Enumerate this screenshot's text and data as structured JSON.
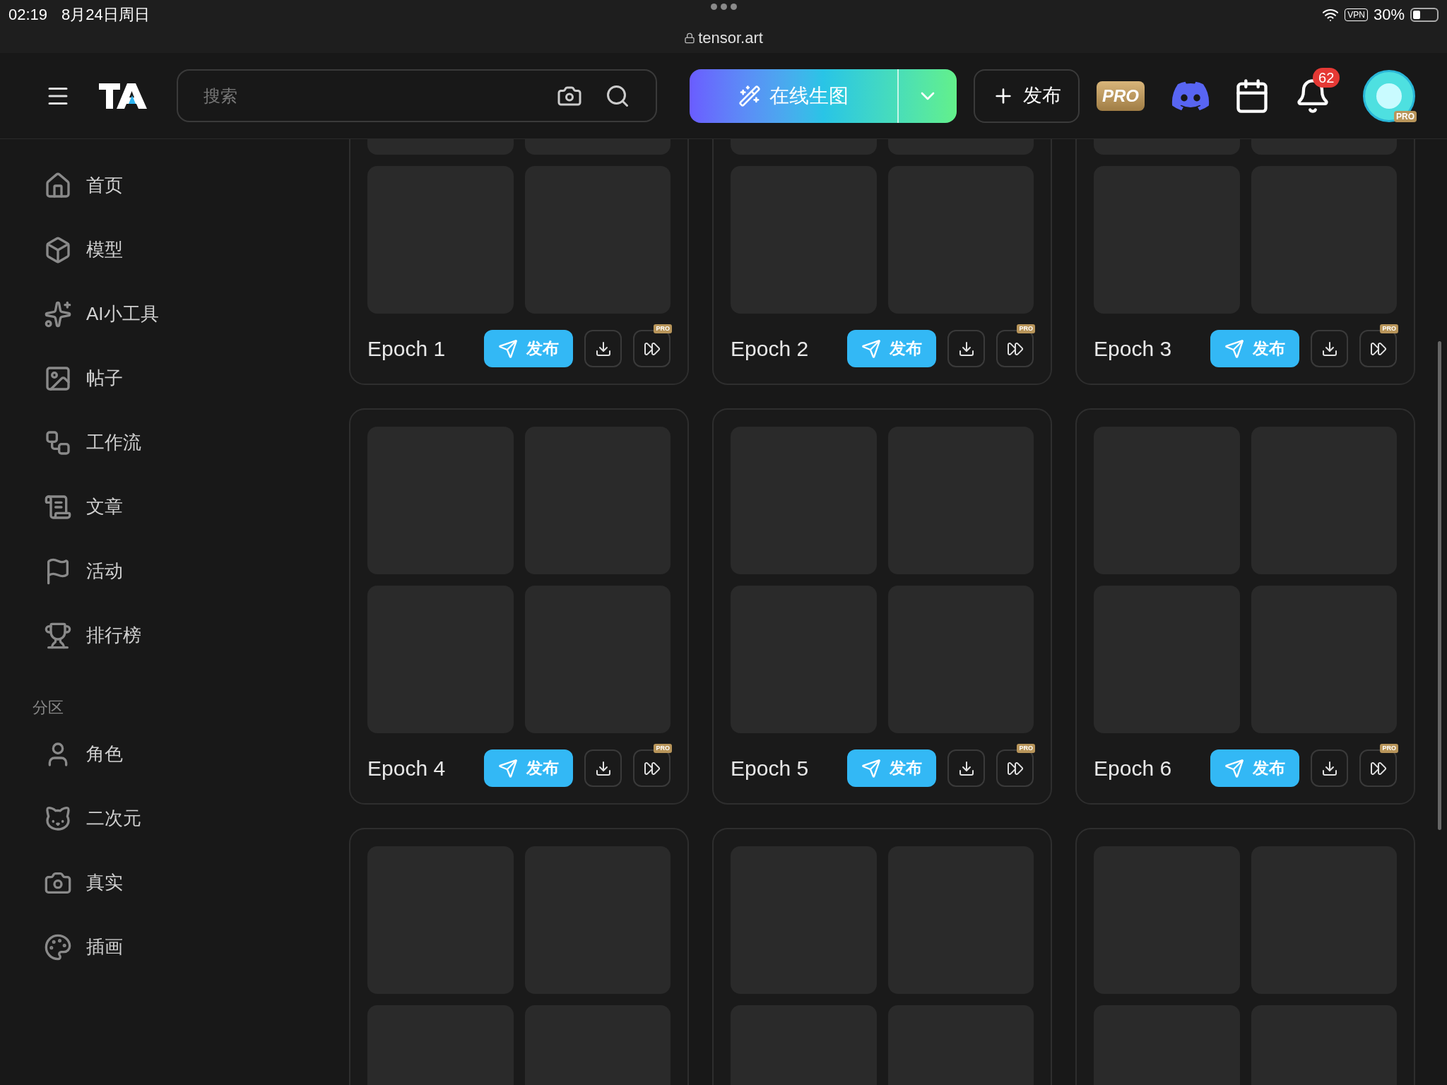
{
  "status_bar": {
    "time": "02:19",
    "date": "8月24日周日",
    "url": "tensor.art",
    "vpn": "VPN",
    "battery": "30%"
  },
  "header": {
    "search": {
      "placeholder": "搜索"
    },
    "generate": "在线生图",
    "publish": "发布",
    "pro": "PRO",
    "notifications": "62",
    "avatar_badge": "PRO"
  },
  "sidebar": {
    "items": [
      {
        "kind": "home",
        "label": "首页"
      },
      {
        "kind": "model",
        "label": "模型"
      },
      {
        "kind": "tools",
        "label": "AI小工具"
      },
      {
        "kind": "posts",
        "label": "帖子"
      },
      {
        "kind": "workflow",
        "label": "工作流"
      },
      {
        "kind": "article",
        "label": "文章"
      },
      {
        "kind": "event",
        "label": "活动"
      },
      {
        "kind": "ranking",
        "label": "排行榜"
      }
    ],
    "section": "分区",
    "section_items": [
      {
        "kind": "character",
        "label": "角色"
      },
      {
        "kind": "anime",
        "label": "二次元"
      },
      {
        "kind": "photo",
        "label": "真实"
      },
      {
        "kind": "illustration",
        "label": "插画"
      }
    ]
  },
  "cards": [
    {
      "kind": "epoch",
      "label": "Epoch 1",
      "publish": "发布",
      "pro": "PRO"
    },
    {
      "kind": "epoch",
      "label": "Epoch 2",
      "publish": "发布",
      "pro": "PRO"
    },
    {
      "kind": "epoch",
      "label": "Epoch 3",
      "publish": "发布",
      "pro": "PRO"
    },
    {
      "kind": "epoch",
      "label": "Epoch 4",
      "publish": "发布",
      "pro": "PRO"
    },
    {
      "kind": "epoch",
      "label": "Epoch 5",
      "publish": "发布",
      "pro": "PRO"
    },
    {
      "kind": "epoch",
      "label": "Epoch 6",
      "publish": "发布",
      "pro": "PRO"
    },
    {
      "kind": "images"
    },
    {
      "kind": "images"
    },
    {
      "kind": "images"
    }
  ]
}
